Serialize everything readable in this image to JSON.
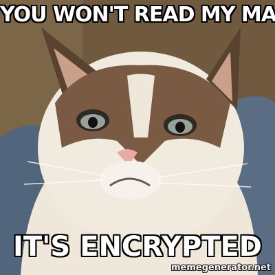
{
  "meme": {
    "top_text": "YOU WON'T READ MY MAIL",
    "bottom_text": "IT'S ENCRYPTED",
    "watermark": "memegenerator.net"
  },
  "colors": {
    "caption_fill": "#ffffff",
    "caption_outline": "#000000",
    "fur_light": "#f2ece2",
    "fur_dark": "#6a4e38",
    "background_wall": "#7a6548",
    "blanket": "#5c6f86"
  }
}
